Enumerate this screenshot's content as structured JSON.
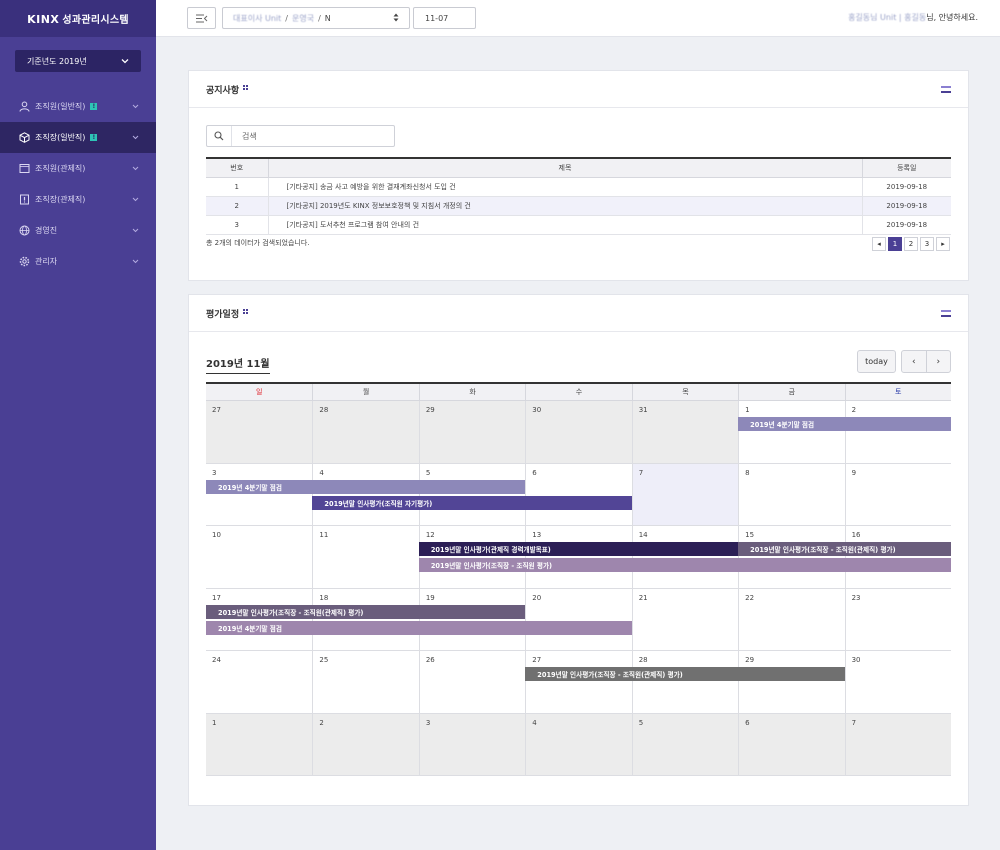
{
  "sidebar": {
    "logo_brand": "KINX",
    "logo_text": "성과관리시스템",
    "year_select": "기준년도 2019년",
    "menu": [
      {
        "label": "조직원(일반직)",
        "badge": "!",
        "icon": "user-icon",
        "active": false
      },
      {
        "label": "조직장(일반직)",
        "badge": "!",
        "icon": "cube-icon",
        "active": true
      },
      {
        "label": "조직원(관제직)",
        "badge": "",
        "icon": "monitor-icon",
        "active": false
      },
      {
        "label": "조직장(관제직)",
        "badge": "",
        "icon": "server-icon",
        "active": false
      },
      {
        "label": "경영진",
        "badge": "",
        "icon": "globe-icon",
        "active": false
      },
      {
        "label": "관리자",
        "badge": "",
        "icon": "gear-icon",
        "active": false
      }
    ]
  },
  "topbar": {
    "org_part1": "대표이사 Unit",
    "org_sep1": "/",
    "org_part2": "운영국",
    "org_sep2": "/",
    "org_part3": "N",
    "code_value": "11-07",
    "greeting_name": "홍길동님 Unit | 홍길동",
    "greeting_suffix": "님, 안녕하세요."
  },
  "notice": {
    "title": "공지사항",
    "search_placeholder": "검색",
    "columns": [
      "번호",
      "제목",
      "등록일"
    ],
    "rows": [
      {
        "no": "1",
        "title": "[기타공지] 송금 사고 예방을 위한 결재계좌신청서 도입 건",
        "date": "2019-09-18"
      },
      {
        "no": "2",
        "title": "[기타공지] 2019년도 KINX 정보보호정책 및 지침서 개정의 건",
        "date": "2019-09-18"
      },
      {
        "no": "3",
        "title": "[기타공지] 도서추천 프로그램 참여 안내의 건",
        "date": "2019-09-18"
      }
    ],
    "result_text": "총 2개의 데이터가 검색되었습니다.",
    "pager": {
      "prev": "◂",
      "pages": [
        "1",
        "2",
        "3"
      ],
      "current": "1",
      "next": "▸"
    }
  },
  "schedule": {
    "title": "평가일정",
    "month_label": "2019년 11월",
    "today_label": "today",
    "prev_label": "‹",
    "next_label": "›",
    "weekdays": [
      "일",
      "월",
      "화",
      "수",
      "목",
      "금",
      "토"
    ],
    "weeks": [
      [
        "27",
        "28",
        "29",
        "30",
        "31",
        "1",
        "2"
      ],
      [
        "3",
        "4",
        "5",
        "6",
        "7",
        "8",
        "9"
      ],
      [
        "10",
        "11",
        "12",
        "13",
        "14",
        "15",
        "16"
      ],
      [
        "17",
        "18",
        "19",
        "20",
        "21",
        "22",
        "23"
      ],
      [
        "24",
        "25",
        "26",
        "27",
        "28",
        "29",
        "30"
      ],
      [
        "1",
        "2",
        "3",
        "4",
        "5",
        "6",
        "7"
      ]
    ],
    "events": [
      {
        "label": "2019년 4분기말 점검",
        "week": 0,
        "start": 5,
        "end": 6,
        "slot": 0,
        "color": "#8d88b9"
      },
      {
        "label": "2019년 4분기말 점검",
        "week": 1,
        "start": 0,
        "end": 2,
        "slot": 0,
        "color": "#8d88b9"
      },
      {
        "label": "2019년말 인사평가(조직원 자기평가)",
        "week": 1,
        "start": 1,
        "end": 3,
        "slot": 1,
        "color": "#524596"
      },
      {
        "label": "2019년말 인사평가(관제직 경력개발목표)",
        "week": 2,
        "start": 2,
        "end": 4,
        "slot": 0,
        "color": "#2c1f56"
      },
      {
        "label": "2019년말 인사평가(조직장 - 조직원(관제직) 평가)",
        "week": 2,
        "start": 5,
        "end": 6,
        "slot": 0,
        "color": "#6a5d7c"
      },
      {
        "label": "2019년말 인사평가(조직장 - 조직원 평가)",
        "week": 2,
        "start": 2,
        "end": 6,
        "slot": 1,
        "color": "#9e86ad"
      },
      {
        "label": "2019년말 인사평가(조직장 - 조직원(관제직) 평가)",
        "week": 3,
        "start": 0,
        "end": 2,
        "slot": 0,
        "color": "#6a5d7c"
      },
      {
        "label": "2019년 4분기말 점검",
        "week": 3,
        "start": 0,
        "end": 3,
        "slot": 1,
        "color": "#9e86ad"
      },
      {
        "label": "2019년말 인사평가(조직장 - 조직원(관제직) 평가)",
        "week": 4,
        "start": 3,
        "end": 5,
        "slot": 0,
        "color": "#707070"
      }
    ]
  }
}
